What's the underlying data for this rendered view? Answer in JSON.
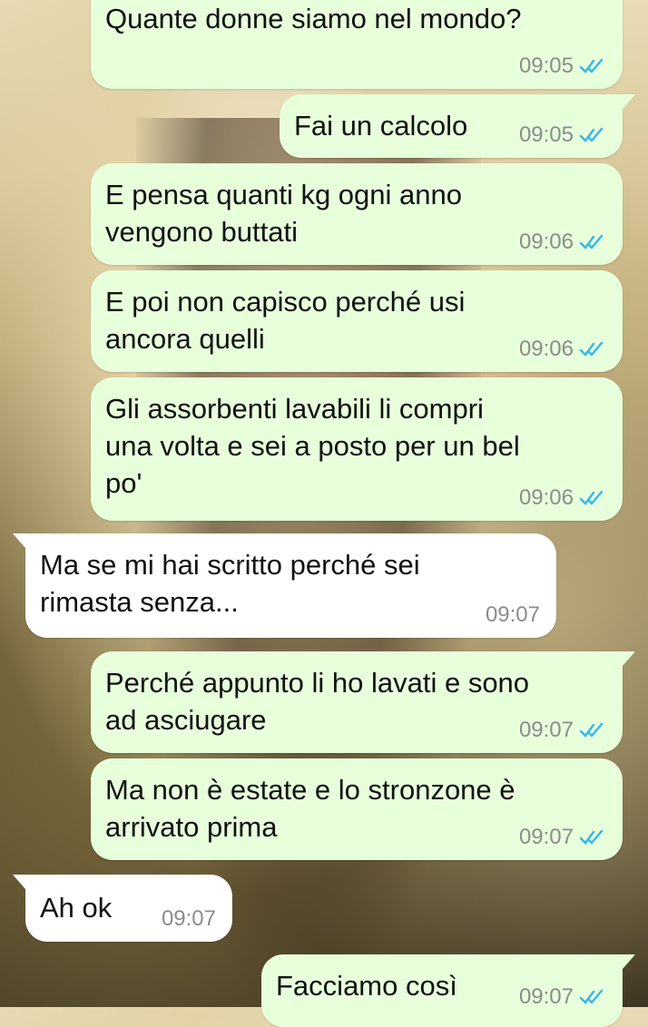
{
  "messages": [
    {
      "text": "Quante donne siamo nel mondo?",
      "time": "09:05",
      "dir": "out",
      "ticks": "double-check-blue-icon"
    },
    {
      "text": "Fai un calcolo",
      "time": "09:05",
      "dir": "out",
      "ticks": "double-check-blue-icon"
    },
    {
      "text": "E pensa quanti kg ogni anno\nvengono buttati",
      "time": "09:06",
      "dir": "out",
      "ticks": "double-check-blue-icon"
    },
    {
      "text": "E poi non capisco perché usi\nancora quelli",
      "time": "09:06",
      "dir": "out",
      "ticks": "double-check-blue-icon"
    },
    {
      "text": "Gli assorbenti lavabili li compri\nuna volta e sei a posto per un bel\npo'",
      "time": "09:06",
      "dir": "out",
      "ticks": "double-check-blue-icon"
    },
    {
      "text": "Ma se mi hai scritto perché sei\nrimasta senza...",
      "time": "09:07",
      "dir": "in"
    },
    {
      "text": "Perché appunto li ho lavati e sono\nad asciugare",
      "time": "09:07",
      "dir": "out",
      "ticks": "double-check-blue-icon"
    },
    {
      "text": "Ma non è estate e lo stronzone è\narrivato prima",
      "time": "09:07",
      "dir": "out",
      "ticks": "double-check-blue-icon"
    },
    {
      "text": "Ah ok",
      "time": "09:07",
      "dir": "in"
    },
    {
      "text": "Facciamo così",
      "time": "09:07",
      "dir": "out",
      "ticks": "double-check-blue-icon"
    }
  ],
  "colors": {
    "outgoing_bubble": "#e7ffdb",
    "incoming_bubble": "#ffffff",
    "read_ticks": "#34b7f1",
    "timestamp": "#8c8c8c"
  }
}
